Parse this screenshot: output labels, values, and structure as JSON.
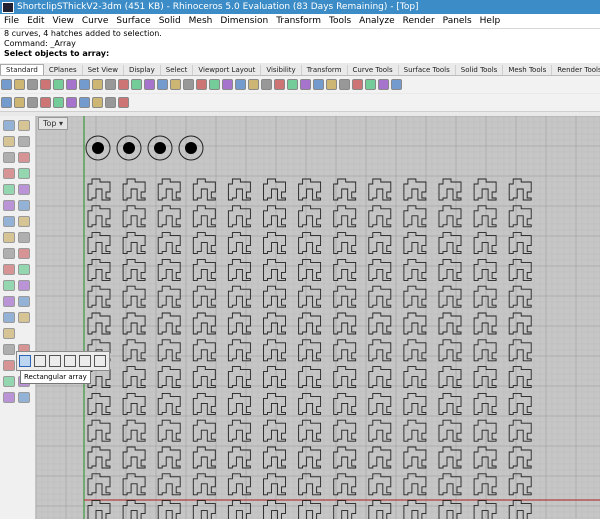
{
  "window": {
    "title": "ShortclipSThickV2-3dm (451 KB) - Rhinoceros 5.0 Evaluation (83 Days Remaining) - [Top]"
  },
  "menu": {
    "items": [
      "File",
      "Edit",
      "View",
      "Curve",
      "Surface",
      "Solid",
      "Mesh",
      "Dimension",
      "Transform",
      "Tools",
      "Analyze",
      "Render",
      "Panels",
      "Help"
    ]
  },
  "command": {
    "history_1": "8 curves, 4 hatches added to selection.",
    "history_2": "Command: _Array",
    "prompt": "Select objects to array:"
  },
  "tabs": [
    "Standard",
    "CPlanes",
    "Set View",
    "Display",
    "Select",
    "Viewport Layout",
    "Visibility",
    "Transform",
    "Curve Tools",
    "Surface Tools",
    "Solid Tools",
    "Mesh Tools",
    "Render Tools"
  ],
  "active_tab": "Standard",
  "viewport": {
    "name": "Top",
    "dropdown_glyph": "▾"
  },
  "tooltip": {
    "text": "Rectangular array"
  },
  "colors": {
    "titlebar": "#3c8cc7",
    "viewport_bg": "#c6c6c6",
    "grid_minor": "#b9b9b9",
    "grid_major": "#a7a7a7",
    "axis_x": "#b04040",
    "axis_y": "#3c9a3c",
    "shape_stroke": "#222222"
  },
  "icons": {
    "toolbar1": [
      "new-icon",
      "open-icon",
      "save-icon",
      "print-icon",
      "import-icon",
      "cut-icon",
      "copy-icon",
      "paste-icon",
      "undo-icon",
      "redo-icon",
      "pan-icon",
      "rotate-icon",
      "zoom-icon",
      "zoom-window-icon",
      "zoom-extents-icon",
      "zoom-selected-icon",
      "zoom-all-icon",
      "4view-icon",
      "perspective-icon",
      "grid-icon",
      "light-icon",
      "camera-icon",
      "lock-icon",
      "layer-icon",
      "color-icon",
      "render-icon",
      "material-icon",
      "environment-icon",
      "osnap-icon",
      "properties-icon",
      "help-icon"
    ],
    "toolbar2": [
      "layer-default-icon",
      "layer-1-icon",
      "layer-2-icon",
      "layer-3-icon",
      "layer-4-icon",
      "layer-5-icon",
      "layer-6-icon",
      "layer-7-icon",
      "layer-8-icon",
      "layer-9-icon"
    ]
  }
}
